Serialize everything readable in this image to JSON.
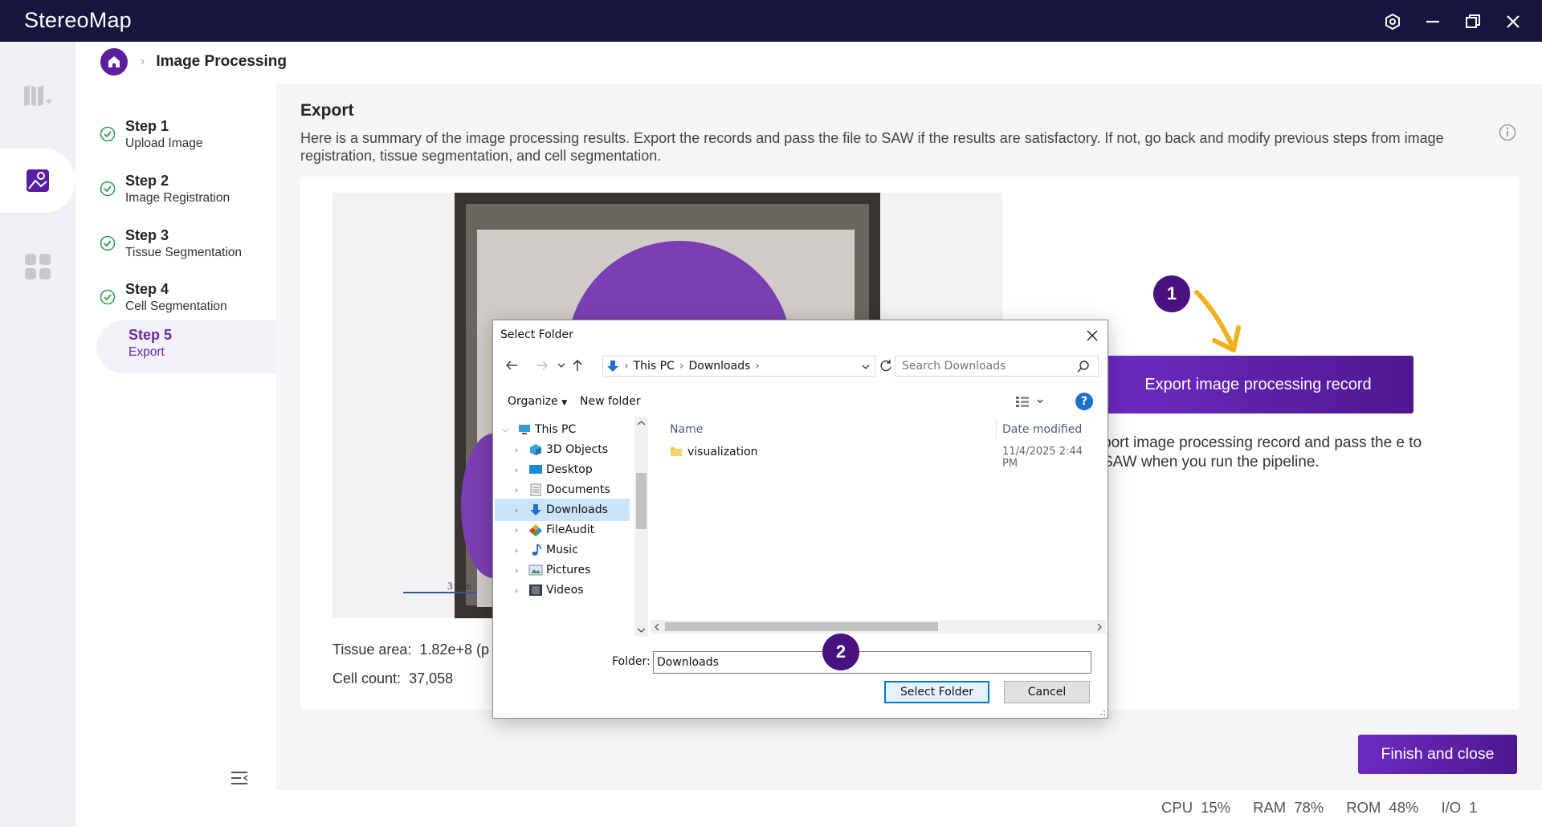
{
  "app": {
    "title": "StereoMap"
  },
  "breadcrumb": {
    "current": "Image Processing"
  },
  "steps": [
    {
      "title": "Step 1",
      "subtitle": "Upload Image",
      "state": "done"
    },
    {
      "title": "Step 2",
      "subtitle": "Image Registration",
      "state": "done"
    },
    {
      "title": "Step 3",
      "subtitle": "Tissue Segmentation",
      "state": "done"
    },
    {
      "title": "Step 4",
      "subtitle": "Cell Segmentation",
      "state": "done"
    },
    {
      "title": "Step 5",
      "subtitle": "Export",
      "state": "active"
    }
  ],
  "export": {
    "title": "Export",
    "description": "Here is a summary of the image processing results. Export the records and pass the file to SAW if the results are satisfactory. If not, go back and modify previous steps from image registration, tissue segmentation, and cell segmentation.",
    "tissue_area_label": "Tissue area:",
    "tissue_area_value": "1.82e+8 (p",
    "cell_count_label": "Cell count:",
    "cell_count_value": "37,058",
    "scale_label": "3 mm",
    "button": "Export image processing record",
    "button_desc": "port image processing record and pass the e to SAW when you run the pipeline.",
    "finish_button": "Finish and close"
  },
  "annotations": {
    "badge1": "1",
    "badge2": "2"
  },
  "status": {
    "cpu_label": "CPU",
    "cpu_value": "15%",
    "ram_label": "RAM",
    "ram_value": "78%",
    "rom_label": "ROM",
    "rom_value": "48%",
    "io_label": "I/O",
    "io_value": "1"
  },
  "dialog": {
    "title": "Select Folder",
    "address": [
      "This PC",
      "Downloads"
    ],
    "search_placeholder": "Search Downloads",
    "organize": "Organize",
    "new_folder": "New folder",
    "help": "?",
    "tree": [
      "This PC",
      "3D Objects",
      "Desktop",
      "Documents",
      "Downloads",
      "FileAudit",
      "Music",
      "Pictures",
      "Videos"
    ],
    "selected_tree_item": "Downloads",
    "columns": {
      "name": "Name",
      "date": "Date modified"
    },
    "rows": [
      {
        "name": "visualization",
        "date": "11/4/2025 2:44 PM"
      }
    ],
    "folder_label": "Folder:",
    "folder_value": "Downloads",
    "select_button": "Select Folder",
    "cancel_button": "Cancel"
  },
  "colors": {
    "accent": "#5b1e9e",
    "titlebar": "#16163f",
    "annotation_arrow": "#f0b21c"
  }
}
